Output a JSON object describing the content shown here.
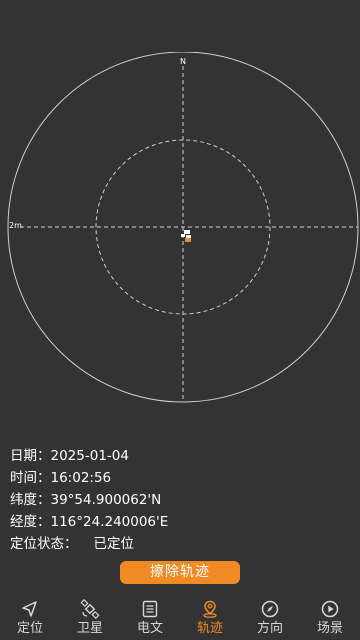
{
  "plot": {
    "north_label": "N",
    "scale_label": "2m"
  },
  "info": {
    "date_label": "日期：",
    "date_value": "2025-01-04",
    "time_label": "时间：",
    "time_value": "16:02:56",
    "lat_label": "纬度：",
    "lat_value": "39°54.900062'N",
    "lon_label": "经度：",
    "lon_value": "116°24.240006'E",
    "status_label": "定位状态：",
    "status_value": "已定位"
  },
  "clear_button_label": "擦除轨迹",
  "navbar": {
    "items": [
      {
        "label": "定位",
        "icon": "navigation-arrow-icon"
      },
      {
        "label": "卫星",
        "icon": "satellite-icon"
      },
      {
        "label": "电文",
        "icon": "document-icon"
      },
      {
        "label": "轨迹",
        "icon": "location-pin-icon"
      },
      {
        "label": "方向",
        "icon": "compass-icon"
      },
      {
        "label": "场景",
        "icon": "play-icon"
      }
    ],
    "active_index": 3
  },
  "colors": {
    "background": "#333333",
    "accent": "#f08a24",
    "grid": "#bdbdbd"
  }
}
